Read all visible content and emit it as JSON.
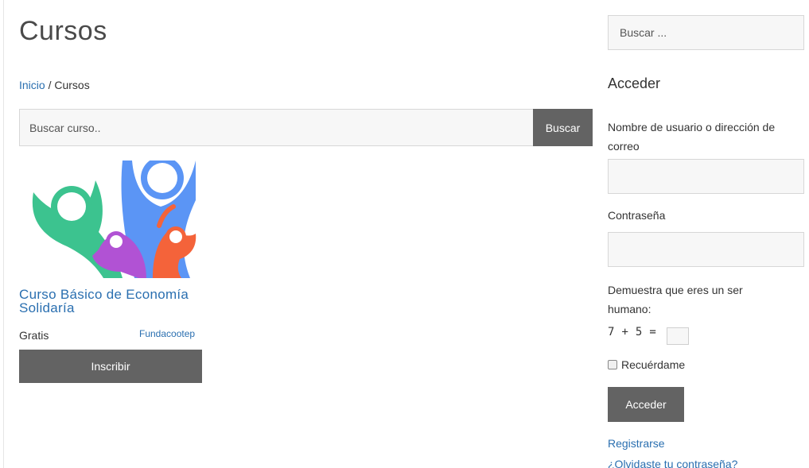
{
  "page": {
    "title": "Cursos"
  },
  "breadcrumb": {
    "home": "Inicio",
    "separator": " / ",
    "current": "Cursos"
  },
  "course_search": {
    "placeholder": "Buscar curso..",
    "button_label": "Buscar"
  },
  "course": {
    "title": "Curso Básico de Economía Solidaría",
    "price": "Gratis",
    "author": "Fundacootep",
    "enroll_label": "Inscribir",
    "image_icon": "people-celebration-logo"
  },
  "sidebar": {
    "search_placeholder": "Buscar ...",
    "login_heading": "Acceder",
    "username_label": "Nombre de usuario o dirección de correo",
    "password_label": "Contraseña",
    "captcha_label": "Demuestra que eres un ser humano:",
    "captcha_a": "7",
    "captcha_op": "+",
    "captcha_b": "5",
    "captcha_eq": "=",
    "remember_label": "Recuérdame",
    "login_button": "Acceder",
    "register_link": "Registrarse",
    "forgot_link": "¿Olvidaste tu contraseña?"
  },
  "colors": {
    "link": "#2a6fb0",
    "button": "#636363",
    "green": "#3cc38f",
    "blue": "#5b95f5",
    "purple": "#b152d4",
    "orange": "#f4633a"
  }
}
